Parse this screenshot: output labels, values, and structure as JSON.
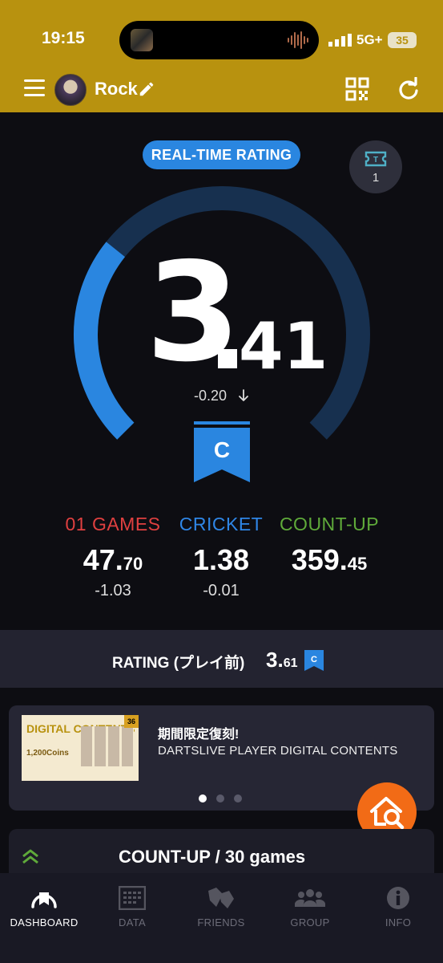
{
  "status_bar": {
    "time": "19:15",
    "network": "5G+",
    "battery": "35"
  },
  "header": {
    "username": "Rock"
  },
  "rating": {
    "badge": "REAL-TIME RATING",
    "ticket_count": "1",
    "integer": "3",
    "decimal": "41",
    "diff": "-0.20",
    "class": "C",
    "gauge_fraction": 0.31,
    "colors": {
      "active": "#2a86e0",
      "track": "#17304f"
    }
  },
  "stats": [
    {
      "label": "01 GAMES",
      "int": "47.",
      "dec": "70",
      "diff": "-1.03",
      "color": "#e04040"
    },
    {
      "label": "CRICKET",
      "int": "1.38",
      "dec": "",
      "diff": "-0.01",
      "color": "#2f86e6"
    },
    {
      "label": "COUNT-UP",
      "int": "359.",
      "dec": "45",
      "diff": "",
      "color": "#5faa3a"
    }
  ],
  "previous_rating": {
    "label": "RATING (プレイ前)",
    "int": "3.",
    "dec": "61",
    "class": "C"
  },
  "promo": {
    "title": "期間限定復刻!",
    "subtitle": "DARTSLIVE PLAYER DIGITAL CONTENTS",
    "image_title": "DIGITAL CONTENTS",
    "image_coins": "1,200Coins",
    "image_corner": "36",
    "active_dot": 0
  },
  "section": {
    "title": "COUNT-UP / 30 games"
  },
  "nav": [
    {
      "label": "DASHBOARD",
      "icon": "dashboard-icon",
      "active": true
    },
    {
      "label": "DATA",
      "icon": "data-icon",
      "active": false
    },
    {
      "label": "FRIENDS",
      "icon": "friends-icon",
      "active": false
    },
    {
      "label": "GROUP",
      "icon": "group-icon",
      "active": false
    },
    {
      "label": "INFO",
      "icon": "info-icon",
      "active": false
    }
  ]
}
